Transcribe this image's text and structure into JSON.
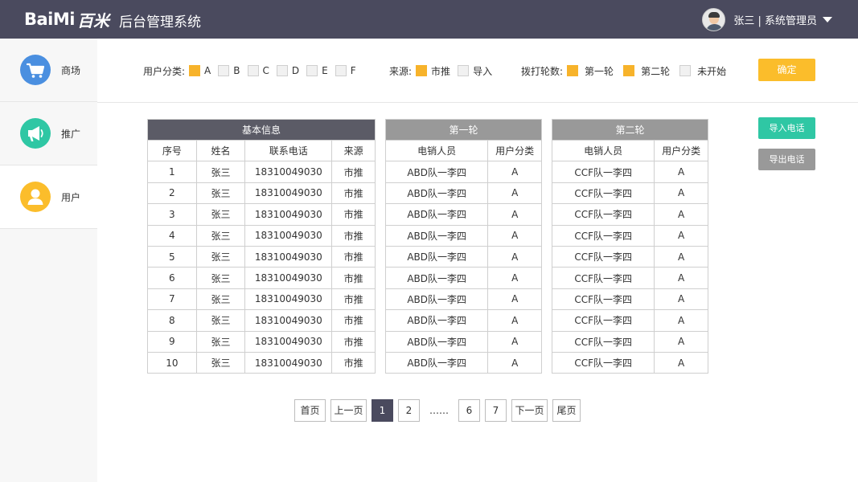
{
  "header": {
    "logo_en": "BaiMi",
    "logo_cn": "百米",
    "system_title": "后台管理系统",
    "user_label": "张三 | 系统管理员"
  },
  "sidebar": {
    "items": [
      {
        "label": "商场",
        "icon": "cart-icon",
        "color": "#4a8fe0"
      },
      {
        "label": "推广",
        "icon": "megaphone-icon",
        "color": "#2fc7a4"
      },
      {
        "label": "用户",
        "icon": "user-icon",
        "color": "#fbbd2b"
      }
    ]
  },
  "filters": {
    "user_category": {
      "label": "用户分类:",
      "options": [
        {
          "label": "A",
          "checked": true
        },
        {
          "label": "B",
          "checked": false
        },
        {
          "label": "C",
          "checked": false
        },
        {
          "label": "D",
          "checked": false
        },
        {
          "label": "E",
          "checked": false
        },
        {
          "label": "F",
          "checked": false
        }
      ]
    },
    "source": {
      "label": "来源:",
      "options": [
        {
          "label": "市推",
          "checked": true
        },
        {
          "label": "导入",
          "checked": false
        }
      ]
    },
    "call_round": {
      "label": "拨打轮数:",
      "options": [
        {
          "label": "第一轮",
          "checked": true
        },
        {
          "label": "第二轮",
          "checked": true
        },
        {
          "label": "未开始",
          "checked": false
        }
      ]
    },
    "confirm_label": "确定"
  },
  "basic_table": {
    "title": "基本信息",
    "columns": [
      "序号",
      "姓名",
      "联系电话",
      "来源"
    ],
    "rows": [
      [
        "1",
        "张三",
        "18310049030",
        "市推"
      ],
      [
        "2",
        "张三",
        "18310049030",
        "市推"
      ],
      [
        "3",
        "张三",
        "18310049030",
        "市推"
      ],
      [
        "4",
        "张三",
        "18310049030",
        "市推"
      ],
      [
        "5",
        "张三",
        "18310049030",
        "市推"
      ],
      [
        "6",
        "张三",
        "18310049030",
        "市推"
      ],
      [
        "7",
        "张三",
        "18310049030",
        "市推"
      ],
      [
        "8",
        "张三",
        "18310049030",
        "市推"
      ],
      [
        "9",
        "张三",
        "18310049030",
        "市推"
      ],
      [
        "10",
        "张三",
        "18310049030",
        "市推"
      ]
    ]
  },
  "round1_table": {
    "title": "第一轮",
    "columns": [
      "电销人员",
      "用户分类"
    ],
    "rows": [
      [
        "ABD队一李四",
        "A"
      ],
      [
        "ABD队一李四",
        "A"
      ],
      [
        "ABD队一李四",
        "A"
      ],
      [
        "ABD队一李四",
        "A"
      ],
      [
        "ABD队一李四",
        "A"
      ],
      [
        "ABD队一李四",
        "A"
      ],
      [
        "ABD队一李四",
        "A"
      ],
      [
        "ABD队一李四",
        "A"
      ],
      [
        "ABD队一李四",
        "A"
      ],
      [
        "ABD队一李四",
        "A"
      ]
    ]
  },
  "round2_table": {
    "title": "第二轮",
    "columns": [
      "电销人员",
      "用户分类"
    ],
    "rows": [
      [
        "CCF队一李四",
        "A"
      ],
      [
        "CCF队一李四",
        "A"
      ],
      [
        "CCF队一李四",
        "A"
      ],
      [
        "CCF队一李四",
        "A"
      ],
      [
        "CCF队一李四",
        "A"
      ],
      [
        "CCF队一李四",
        "A"
      ],
      [
        "CCF队一李四",
        "A"
      ],
      [
        "CCF队一李四",
        "A"
      ],
      [
        "CCF队一李四",
        "A"
      ],
      [
        "CCF队一李四",
        "A"
      ]
    ]
  },
  "actions": {
    "import_label": "导入电话",
    "import_color": "#2fc7a4",
    "export_label": "导出电话",
    "export_color": "#999999"
  },
  "pagination": {
    "first": "首页",
    "prev": "上一页",
    "pages": [
      "1",
      "2"
    ],
    "ellipsis": "……",
    "tail_pages": [
      "6",
      "7"
    ],
    "next": "下一页",
    "last": "尾页",
    "current": "1"
  }
}
